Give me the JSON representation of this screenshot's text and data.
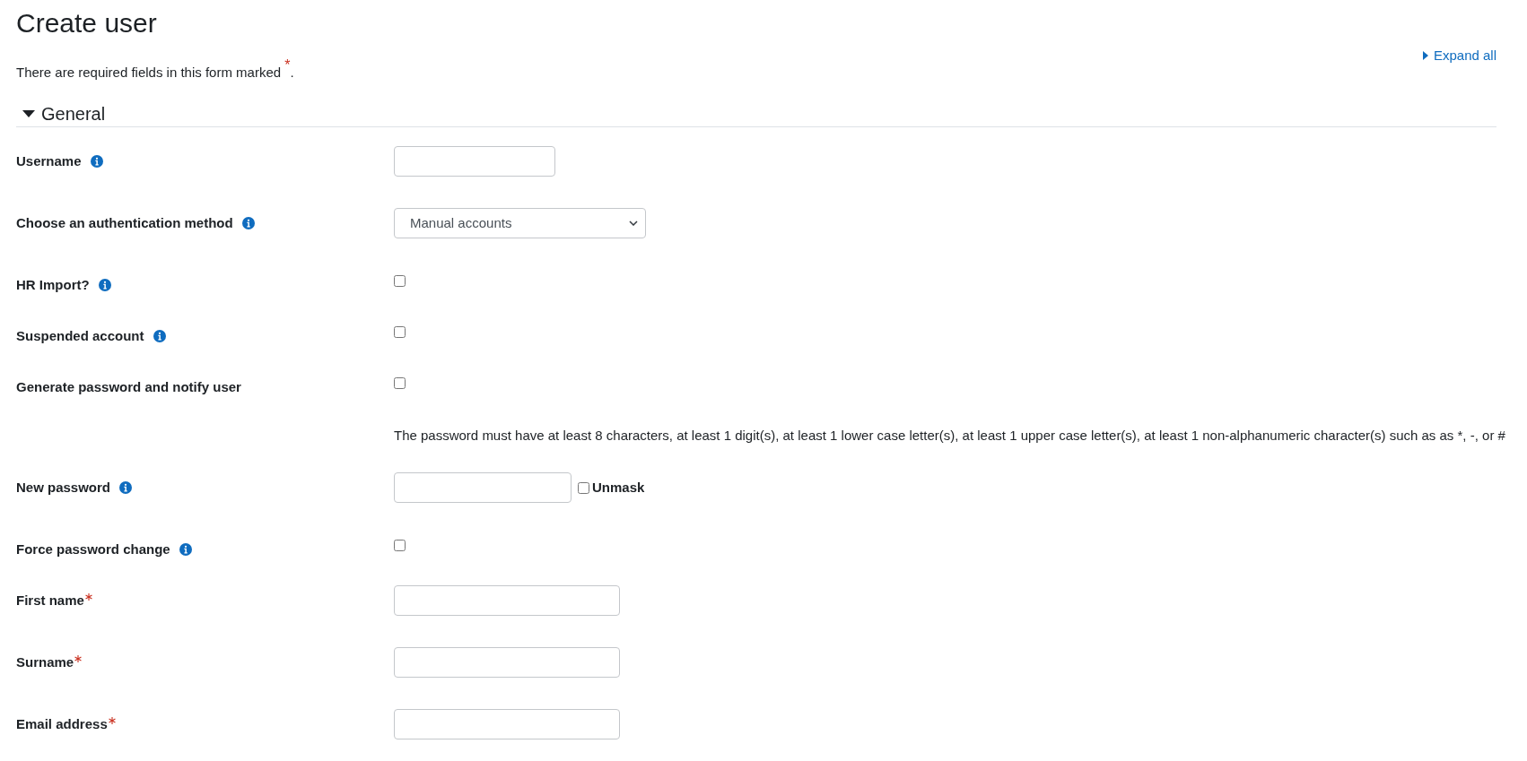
{
  "page": {
    "title": "Create user"
  },
  "intro": "There are required fields in this form marked $^{*}$.",
  "expand_all": {
    "label": "Expand all"
  },
  "section": {
    "title": "General",
    "expanded": true
  },
  "fields": [
    {
      "kind": "text",
      "label": "Username",
      "help": true,
      "required": false
    },
    {
      "kind": "select",
      "label": "Choose an authentication method",
      "help": true,
      "required": false,
      "value": "Manual accounts"
    },
    {
      "kind": "checkbox",
      "label": "HR Import?",
      "help": true,
      "required": false,
      "checked": false
    },
    {
      "kind": "checkbox",
      "label": "Suspended account",
      "help": true,
      "required": false,
      "checked": false
    },
    {
      "kind": "checkbox",
      "label": "Generate password and notify user",
      "help": false,
      "required": false,
      "checked": false
    },
    {
      "kind": "note",
      "text": "The password must have at least 8 characters, at least 1 digit(s), at least 1 lower case letter(s), at least 1 upper case letter(s), at least 1 non-alphanumeric character(s) such as as *, -, or #"
    },
    {
      "kind": "password",
      "label": "New password",
      "help": true,
      "required": false,
      "unmask": {
        "label": "Unmask",
        "checked": false
      }
    },
    {
      "kind": "checkbox",
      "label": "Force password change",
      "help": true,
      "required": false,
      "checked": false
    },
    {
      "kind": "text",
      "label": "First name",
      "help": false,
      "required": true
    },
    {
      "kind": "text",
      "label": "Surname",
      "help": false,
      "required": true
    },
    {
      "kind": "text",
      "label": "Email address",
      "help": false,
      "required": true
    }
  ]
}
